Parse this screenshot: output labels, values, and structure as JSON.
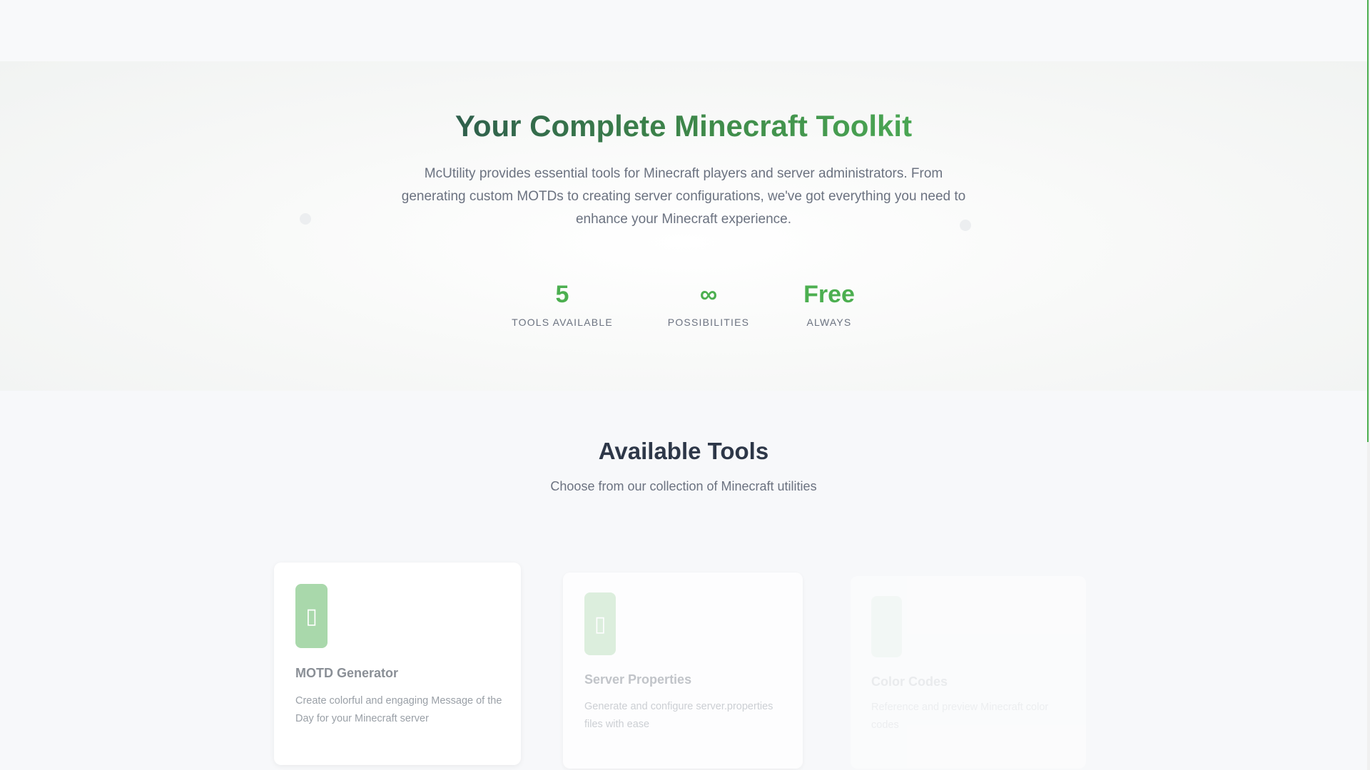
{
  "hero": {
    "title": "Your Complete Minecraft Toolkit",
    "description": "McUtility provides essential tools for Minecraft players and server administrators. From generating custom MOTDs to creating server configurations, we've got everything you need to enhance your Minecraft experience."
  },
  "stats": [
    {
      "value": "5",
      "label": "TOOLS AVAILABLE"
    },
    {
      "value": "∞",
      "label": "POSSIBILITIES"
    },
    {
      "value": "Free",
      "label": "ALWAYS"
    }
  ],
  "tools_section": {
    "title": "Available Tools",
    "subtitle": "Choose from our collection of Minecraft utilities"
  },
  "tools": [
    {
      "title": "MOTD Generator",
      "description": "Create colorful and engaging Message of the Day for your Minecraft server",
      "icon": "motd-icon"
    },
    {
      "title": "Server Properties",
      "description": "Generate and configure server.properties files with ease",
      "icon": "server-icon"
    },
    {
      "title": "Color Codes",
      "description": "Reference and preview Minecraft color codes",
      "icon": "color-icon"
    }
  ],
  "colors": {
    "accent": "#4caf50",
    "title_gradient_start": "#2f5f4c",
    "title_gradient_end": "#4aa653"
  }
}
